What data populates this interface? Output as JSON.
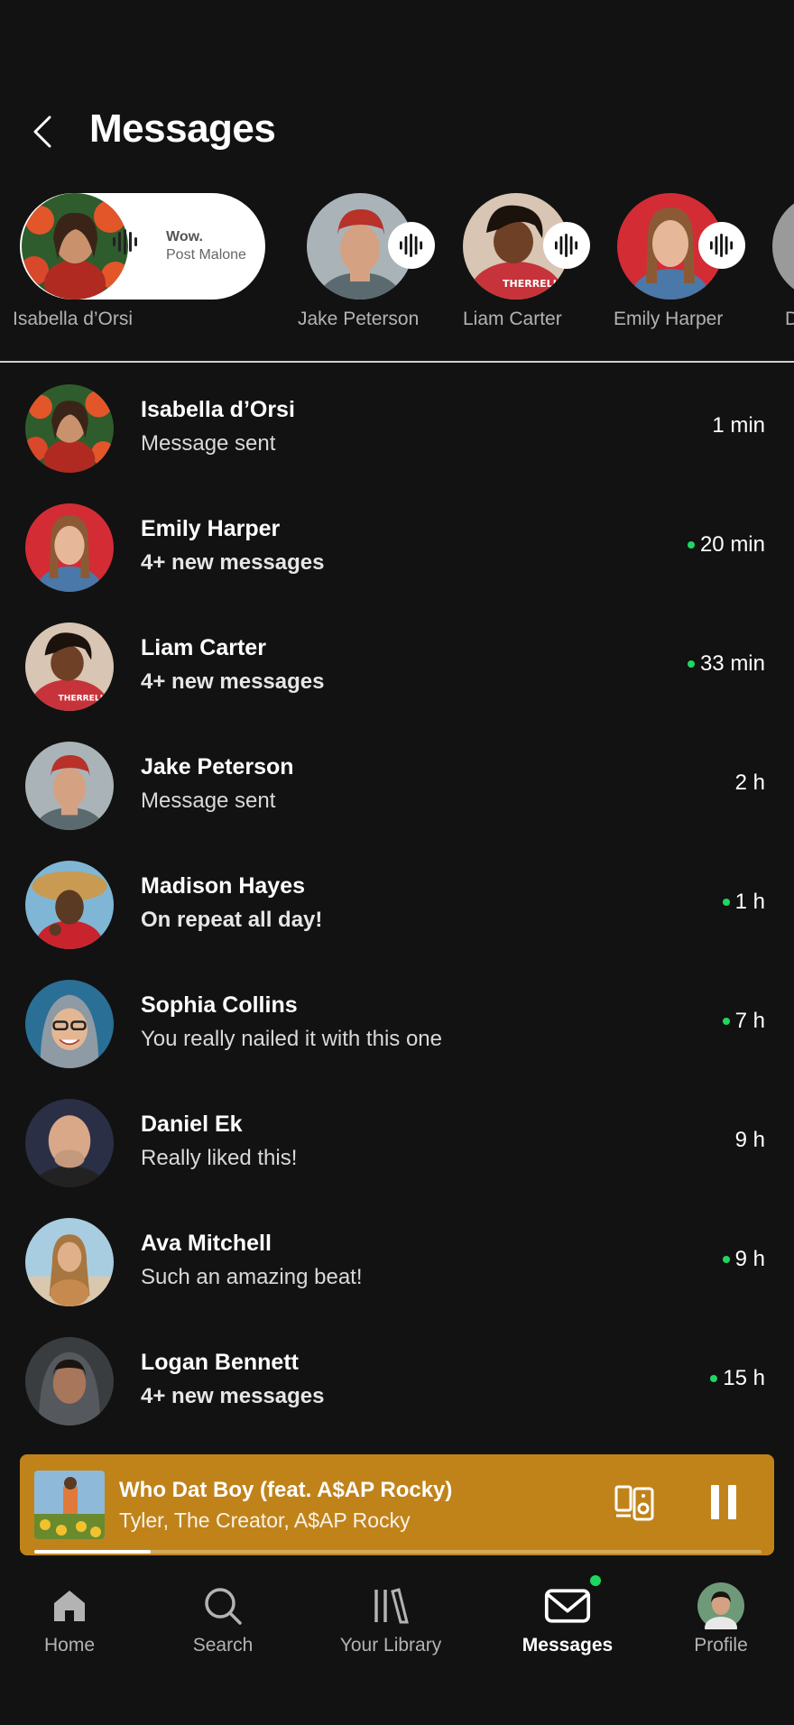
{
  "header": {
    "title": "Messages"
  },
  "active_story": {
    "name": "Isabella d’Orsi",
    "song": "Wow.",
    "artist": "Post Malone"
  },
  "stories": [
    {
      "name": "Jake Peterson"
    },
    {
      "name": "Liam Carter"
    },
    {
      "name": "Emily Harper"
    },
    {
      "name": "D"
    }
  ],
  "messages": [
    {
      "name": "Isabella d’Orsi",
      "preview": "Message sent",
      "time": "1 min",
      "unread": false
    },
    {
      "name": "Emily Harper",
      "preview": "4+ new messages",
      "time": "20 min",
      "unread": true
    },
    {
      "name": "Liam Carter",
      "preview": "4+ new messages",
      "time": "33 min",
      "unread": true
    },
    {
      "name": "Jake Peterson",
      "preview": "Message sent",
      "time": "2 h",
      "unread": false
    },
    {
      "name": "Madison Hayes",
      "preview": "On repeat all day!",
      "time": "1 h",
      "unread": true
    },
    {
      "name": "Sophia Collins",
      "preview": "You really nailed it with this one",
      "time": "7 h",
      "unread": true
    },
    {
      "name": "Daniel Ek",
      "preview": "Really liked this!",
      "time": "9 h",
      "unread": false
    },
    {
      "name": "Ava Mitchell",
      "preview": "Such an amazing beat!",
      "time": "9 h",
      "unread": true
    },
    {
      "name": "Logan Bennett",
      "preview": "4+ new messages",
      "time": "15 h",
      "unread": true
    }
  ],
  "player": {
    "track": "Who Dat Boy (feat. A$AP Rocky)",
    "artist": "Tyler, The Creator, A$AP Rocky",
    "progress": 0.16,
    "color": "#c0831a"
  },
  "nav": {
    "home": "Home",
    "search": "Search",
    "library": "Your Library",
    "messages": "Messages",
    "profile": "Profile"
  },
  "colors": {
    "accent": "#1ed760",
    "background": "#121212"
  }
}
